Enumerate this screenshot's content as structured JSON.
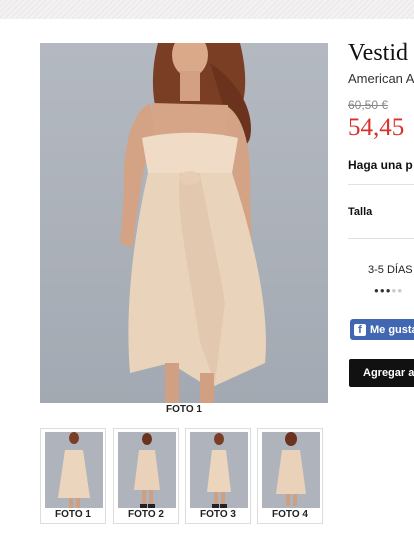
{
  "product": {
    "title": "Vestid",
    "brand": "American A",
    "old_price": "60,50 €",
    "price": "54,45",
    "ask_question": "Haga una p",
    "size_label": "Talla",
    "delivery": "3-5 DÍAS",
    "delivery_dots_filled": 3,
    "delivery_dots_total": 5
  },
  "gallery": {
    "main_caption": "FOTO 1",
    "thumbnails": [
      {
        "caption": "FOTO 1"
      },
      {
        "caption": "FOTO 2"
      },
      {
        "caption": "FOTO 3"
      },
      {
        "caption": "FOTO 4"
      }
    ]
  },
  "social": {
    "like_label": "Me gusta",
    "icon": "facebook-icon"
  },
  "cart": {
    "add_label": "Agregar a"
  },
  "colors": {
    "price": "#d9302c",
    "like_button": "#4267b2",
    "cart_button": "#111111"
  }
}
